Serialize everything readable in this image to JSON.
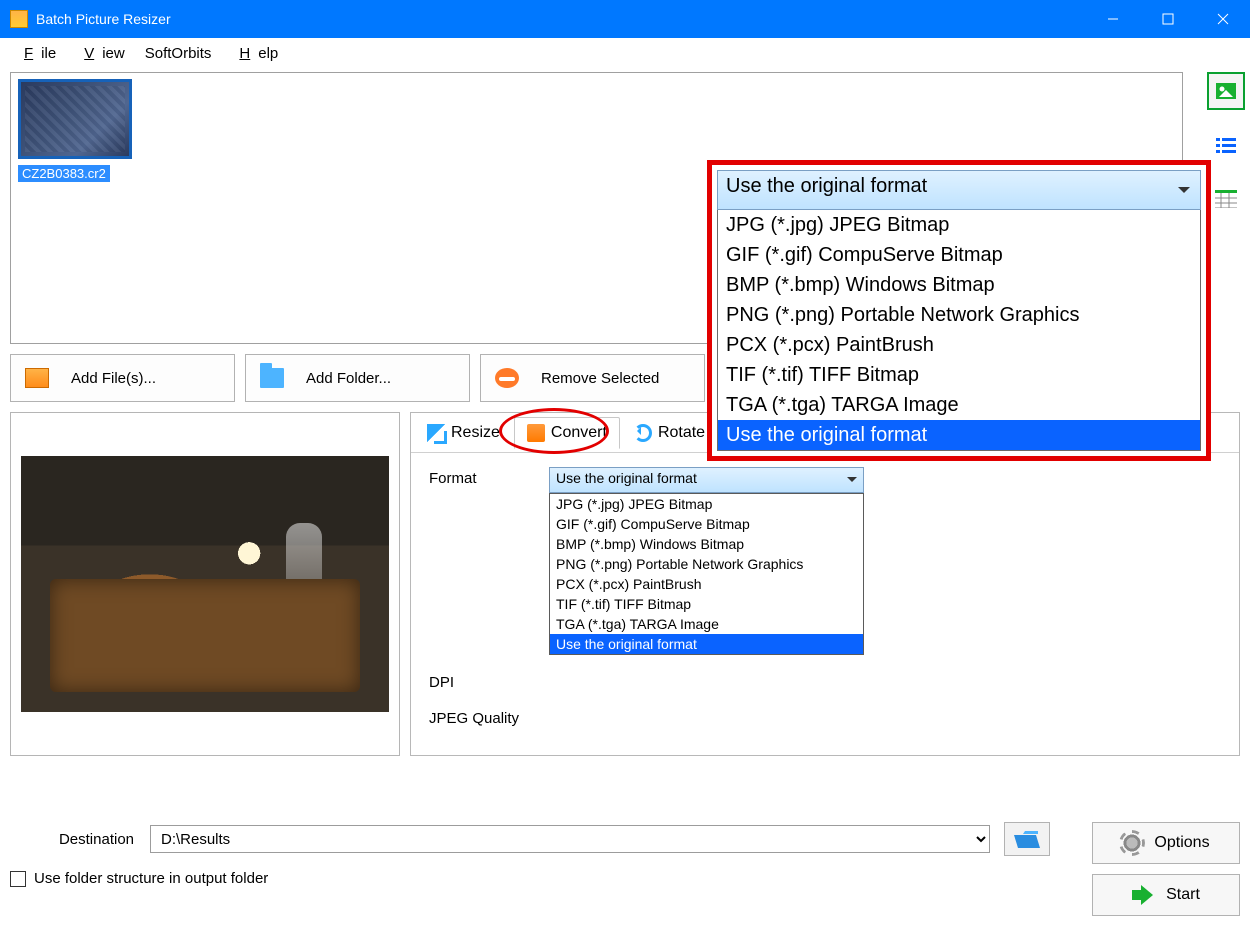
{
  "title": "Batch Picture Resizer",
  "menu": {
    "file": "File",
    "view": "View",
    "softorbits": "SoftOrbits",
    "help": "Help"
  },
  "thumb": {
    "filename": "CZ2B0383.cr2"
  },
  "actions": {
    "add_files": "Add File(s)...",
    "add_folder": "Add Folder...",
    "remove_selected": "Remove Selected"
  },
  "tabs": {
    "resize": "Resize",
    "convert": "Convert",
    "rotate": "Rotate"
  },
  "convert": {
    "format_label": "Format",
    "dpi_label": "DPI",
    "jpeg_quality_label": "JPEG Quality",
    "selected": "Use the original format",
    "options": [
      "JPG (*.jpg) JPEG Bitmap",
      "GIF (*.gif) CompuServe Bitmap",
      "BMP (*.bmp) Windows Bitmap",
      "PNG (*.png) Portable Network Graphics",
      "PCX (*.pcx) PaintBrush",
      "TIF (*.tif) TIFF Bitmap",
      "TGA (*.tga) TARGA Image",
      "Use the original format"
    ]
  },
  "callout": {
    "selected": "Use the original format",
    "options": [
      "JPG (*.jpg) JPEG Bitmap",
      "GIF (*.gif) CompuServe Bitmap",
      "BMP (*.bmp) Windows Bitmap",
      "PNG (*.png) Portable Network Graphics",
      "PCX (*.pcx) PaintBrush",
      "TIF (*.tif) TIFF Bitmap",
      "TGA (*.tga) TARGA Image",
      "Use the original format"
    ]
  },
  "destination": {
    "label": "Destination",
    "value": "D:\\Results"
  },
  "use_folder_structure": "Use folder structure in output folder",
  "buttons": {
    "options": "Options",
    "start": "Start"
  }
}
